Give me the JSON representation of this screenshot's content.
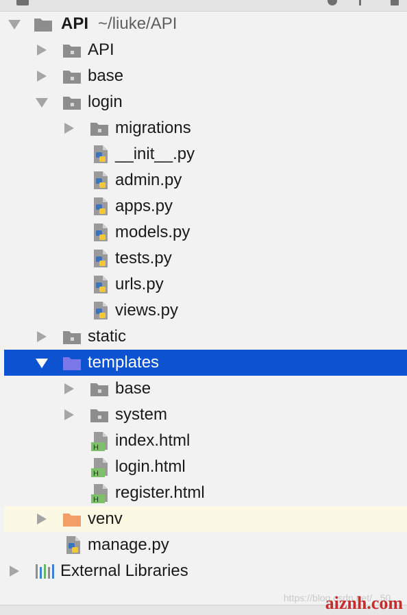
{
  "project_root": {
    "name": "API",
    "path": "~/liuke/API"
  },
  "tree": [
    {
      "label": "API",
      "kind": "folder",
      "state": "collapsed"
    },
    {
      "label": "base",
      "kind": "folder",
      "state": "collapsed"
    },
    {
      "label": "login",
      "kind": "folder",
      "state": "expanded"
    },
    {
      "label": "migrations",
      "kind": "folder",
      "state": "collapsed"
    },
    {
      "label": "__init__.py",
      "kind": "python-file"
    },
    {
      "label": "admin.py",
      "kind": "python-file"
    },
    {
      "label": "apps.py",
      "kind": "python-file"
    },
    {
      "label": "models.py",
      "kind": "python-file"
    },
    {
      "label": "tests.py",
      "kind": "python-file"
    },
    {
      "label": "urls.py",
      "kind": "python-file"
    },
    {
      "label": "views.py",
      "kind": "python-file"
    },
    {
      "label": "static",
      "kind": "folder",
      "state": "collapsed"
    },
    {
      "label": "templates",
      "kind": "templates-folder",
      "state": "expanded",
      "selected": true
    },
    {
      "label": "base",
      "kind": "folder",
      "state": "collapsed"
    },
    {
      "label": "system",
      "kind": "folder",
      "state": "collapsed"
    },
    {
      "label": "index.html",
      "kind": "html-file"
    },
    {
      "label": "login.html",
      "kind": "html-file"
    },
    {
      "label": "register.html",
      "kind": "html-file"
    },
    {
      "label": "venv",
      "kind": "venv-folder",
      "state": "collapsed"
    },
    {
      "label": "manage.py",
      "kind": "python-file"
    },
    {
      "label": "External Libraries",
      "kind": "libraries",
      "state": "collapsed"
    }
  ],
  "watermark": {
    "text": "https://blog.csdn.net/...50...",
    "brand": "aiznh.com"
  },
  "colors": {
    "selection": "#0d52d0",
    "venv_highlight": "#fbf8e3",
    "folder": "#8d8d8d",
    "templates_folder": "#7a78e8",
    "venv_folder": "#f39e67"
  }
}
